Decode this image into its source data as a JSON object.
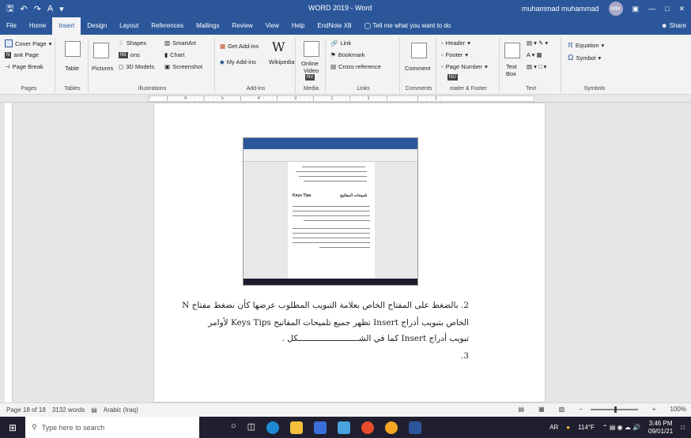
{
  "titlebar": {
    "title": "WORD 2019  -  Word",
    "user": "muhammad muhammad",
    "avatar": "MM",
    "quick_icons": [
      "save-icon",
      "undo-icon",
      "redo-icon",
      "font-color-icon",
      "customize-icon"
    ]
  },
  "menu": {
    "tabs": [
      "File",
      "Home",
      "Insert",
      "Design",
      "Layout",
      "References",
      "Mailings",
      "Review",
      "View",
      "Help",
      "EndNote X8"
    ],
    "active": "Insert",
    "tell_me": "Tell me what you want to do",
    "share": "Share"
  },
  "ribbon": {
    "pages": {
      "cover_page": "Cover Page",
      "blank_page_tip": "N",
      "blank_page": "ank Page",
      "page_break": "Page Break",
      "label": "Pages"
    },
    "tables": {
      "table": "Table",
      "label": "Tables"
    },
    "illustrations": {
      "pictures": "Pictures",
      "shapes": "Shapes",
      "icons_tip": "N5",
      "icons": "ons",
      "models": "3D Models",
      "smartart": "SmartArt",
      "chart": "Chart",
      "screenshot": "Screenshot",
      "label": "Illustrations"
    },
    "addins": {
      "get": "Get Add-ins",
      "my": "My Add-ins",
      "wikipedia": "Wikipedia",
      "label": "Add-ins"
    },
    "media": {
      "online_video_1": "Online",
      "online_video_2": "Video",
      "tip": "NV",
      "label": "Media"
    },
    "links": {
      "link": "Link",
      "bookmark": "Bookmark",
      "cross_reference": "Cross-reference",
      "label": "Links"
    },
    "comments": {
      "comment": "Comment",
      "label": "Comments"
    },
    "header_footer": {
      "header": "Header",
      "footer": "Footer",
      "page_number": "Page Number",
      "tip": "NU",
      "label": "eader & Footer"
    },
    "text": {
      "text_box_1": "Text",
      "text_box_2": "Box",
      "label": "Text"
    },
    "symbols": {
      "equation": "Equation",
      "symbol": "Symbol",
      "label": "Symbols"
    }
  },
  "ruler_text": "7 · · · | · · · 6 · · · | · · · 5 · · · | · · · 4 · · · | · · · 3 · · · | · · · 2 · · · | · · · 1 · · · | · · · · · · | · · · 1 ·",
  "document": {
    "embedded": {
      "keys_tips": "Keys Tips",
      "arabic_heading": "تلميحات المفاتيح"
    },
    "line1": "2. بالضغط على المفتاح الخاص بعلامة التبويب المطلوب عرضها كأن نضغط مفتاح N",
    "line2": "الخاص بتبويب أدراج Insert تظهر جميع تلميحات المفاتيح Keys Tips لأوامر",
    "line3": "تبويب أدراج Insert كما في الشـــــــــــــــــــــــــكل .",
    "line4": "3."
  },
  "status": {
    "page": "Page 18 of 18",
    "words": "3132 words",
    "language": "Arabic (Iraq)",
    "zoom": "100%"
  },
  "taskbar": {
    "search_placeholder": "Type here to search",
    "weather": "114°F",
    "lang": "AR",
    "time": "3:46 PM",
    "date": "09/01/21"
  }
}
